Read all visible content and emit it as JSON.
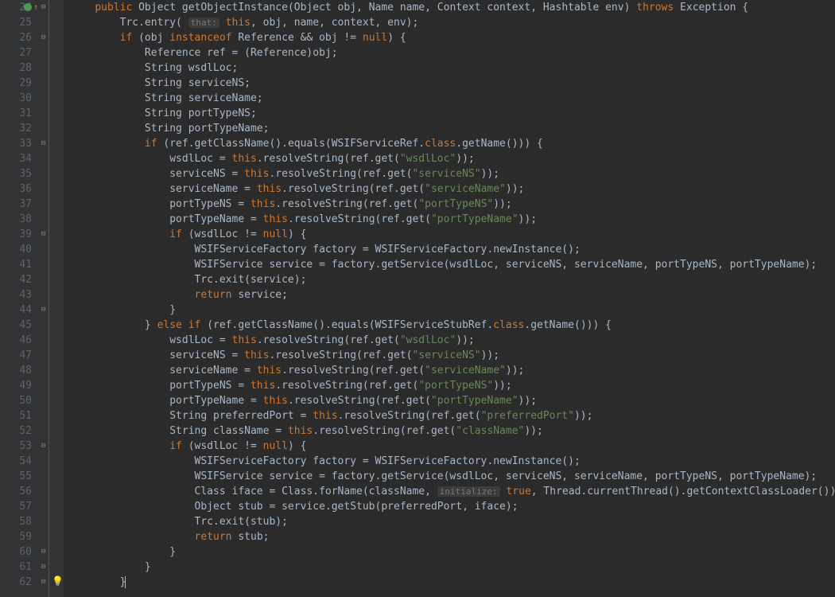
{
  "lineStart": 24,
  "lineEnd": 62,
  "foldLines": [
    24,
    26,
    33,
    39,
    44,
    53,
    60,
    61,
    62
  ],
  "bulbLine": 62,
  "overrideLine": 24,
  "caretLine": 62,
  "tokens": {
    "public": "public",
    "Object": "Object",
    "getObjectInstance": "getObjectInstance",
    "obj": "obj",
    "Name": "Name",
    "name": "name",
    "Context": "Context",
    "context": "context",
    "Hashtable": "Hashtable",
    "env": "env",
    "throws": "throws",
    "Exception": "Exception",
    "Trc": "Trc",
    "entry": "entry",
    "that": "that:",
    "this": "this",
    "if": "if",
    "instanceof": "instanceof",
    "Reference": "Reference",
    "null": "null",
    "ref": "ref",
    "String": "String",
    "wsdlLoc": "wsdlLoc",
    "serviceNS": "serviceNS",
    "serviceName": "serviceName",
    "portTypeNS": "portTypeNS",
    "portTypeName": "portTypeName",
    "getClassName": "getClassName",
    "equals": "equals",
    "WSIFServiceRef": "WSIFServiceRef",
    "class_kw": "class",
    "getName": "getName",
    "resolveString": "resolveString",
    "get": "get",
    "s_wsdlLoc": "\"wsdlLoc\"",
    "s_serviceNS": "\"serviceNS\"",
    "s_serviceName": "\"serviceName\"",
    "s_portTypeNS": "\"portTypeNS\"",
    "s_portTypeName": "\"portTypeName\"",
    "s_preferredPort": "\"preferredPort\"",
    "s_className": "\"className\"",
    "WSIFServiceFactory": "WSIFServiceFactory",
    "factory": "factory",
    "newInstance": "newInstance",
    "WSIFService": "WSIFService",
    "service": "service",
    "getService": "getService",
    "exit": "exit",
    "return": "return",
    "else": "else",
    "WSIFServiceStubRef": "WSIFServiceStubRef",
    "preferredPort": "preferredPort",
    "className": "className",
    "Class": "Class",
    "iface": "iface",
    "forName": "forName",
    "initialize": "initialize:",
    "true": "true",
    "Thread": "Thread",
    "currentThread": "currentThread",
    "getContextClassLoader": "getContextClassLoader",
    "stub": "stub",
    "getStub": "getStub"
  }
}
